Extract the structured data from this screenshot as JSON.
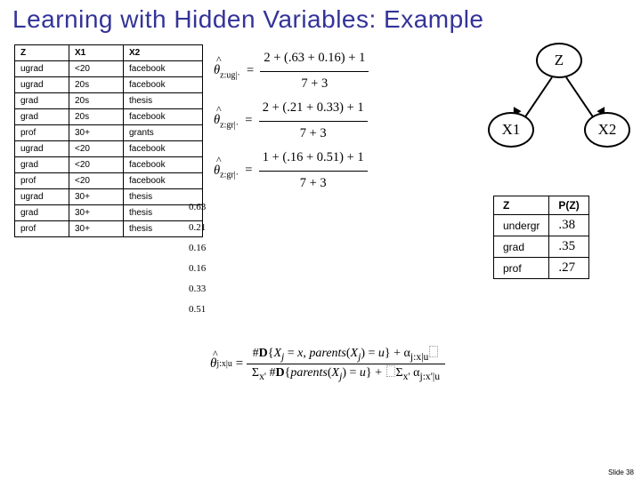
{
  "title": "Learning with Hidden Variables: Example",
  "table": {
    "headers": [
      "Z",
      "X1",
      "X2"
    ],
    "rows": [
      [
        "ugrad",
        "<20",
        "facebook"
      ],
      [
        "ugrad",
        "20s",
        "facebook"
      ],
      [
        "grad",
        "20s",
        "thesis"
      ],
      [
        "grad",
        "20s",
        "facebook"
      ],
      [
        "prof",
        "30+",
        "grants"
      ],
      [
        "ugrad",
        "<20",
        "facebook"
      ],
      [
        "grad",
        "<20",
        "facebook"
      ],
      [
        "prof",
        "<20",
        "facebook"
      ],
      [
        "ugrad",
        "30+",
        "thesis"
      ],
      [
        "grad",
        "30+",
        "thesis"
      ],
      [
        "prof",
        "30+",
        "thesis"
      ]
    ]
  },
  "equations": {
    "r1": {
      "lhs": "θ",
      "sub": "z:ug|·",
      "num": "2 + (.63 + 0.16) + 1",
      "den": "7 + 3"
    },
    "r2": {
      "lhs": "θ",
      "sub": "z:gr|·",
      "num": "2 + (.21 + 0.33) + 1",
      "den": "7 + 3"
    },
    "r3": {
      "lhs": "θ",
      "sub": "z:gr|·",
      "num": "1 + (.16 + 0.51) + 1",
      "den": "7 + 3"
    }
  },
  "column_vals": [
    "0.63",
    "0.21",
    "0.16",
    "0.16",
    "0.33",
    "0.51"
  ],
  "graph": {
    "z": "Z",
    "x1": "X1",
    "x2": "X2"
  },
  "pz": {
    "headers": [
      "Z",
      "P(Z)"
    ],
    "rows": [
      [
        "undergr",
        ".38"
      ],
      [
        "grad",
        ".35"
      ],
      [
        "prof",
        ".27"
      ]
    ]
  },
  "formula": {
    "lhs_sym": "θ",
    "lhs_sub": "j:x|u",
    "num": "#D{Xj = x, parents(Xj) = u} + αj:x|u",
    "den1": "Σx' #D{parents(Xj) = u} + ",
    "den2": "Σx' αj:x'|u"
  },
  "slide_num": "Slide 38"
}
